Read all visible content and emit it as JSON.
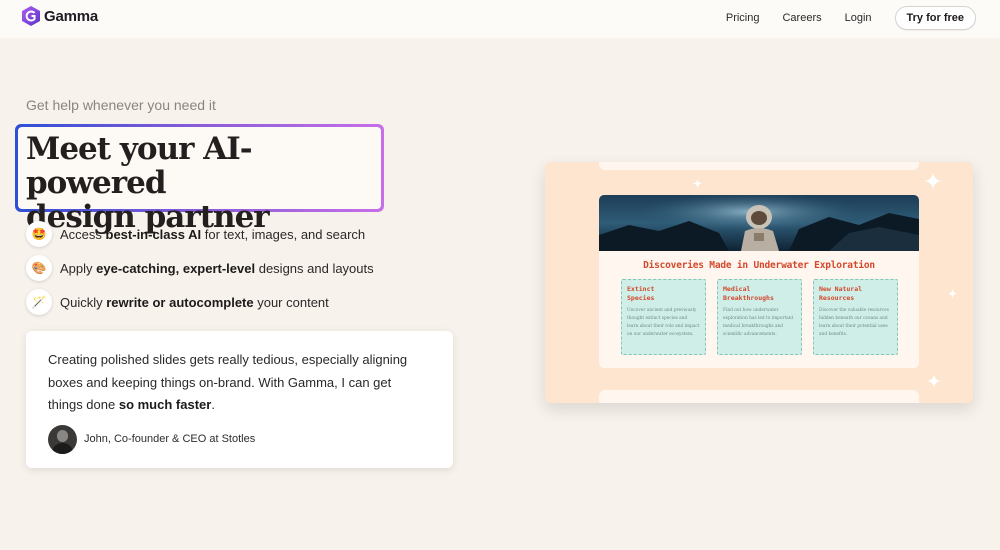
{
  "brand": {
    "name": "Gamma",
    "accent": "#7b4de0"
  },
  "nav": {
    "links": [
      "Pricing",
      "Careers",
      "Login"
    ],
    "cta": "Try for free"
  },
  "hero": {
    "eyebrow": "Get help whenever you need it",
    "headline_line1": "Meet your AI-powered",
    "headline_line2": "design partner",
    "gradient": [
      "#2e4fd6",
      "#8a5cd8",
      "#c86ee8"
    ]
  },
  "features": [
    {
      "icon": "star-struck-emoji-icon",
      "pre": "Access ",
      "bold": "best-in-class AI",
      "post": " for text, images, and search"
    },
    {
      "icon": "palette-icon",
      "pre": "Apply ",
      "bold": "eye-catching, expert-level",
      "post": " designs and layouts"
    },
    {
      "icon": "magic-wand-icon",
      "pre": "Quickly ",
      "bold": "rewrite or autocomplete",
      "post": " your content"
    }
  ],
  "testimonial": {
    "line1": "Creating polished slides gets really tedious, especially aligning",
    "line2": "boxes and keeping things on-brand. With Gamma, I can get",
    "line3_pre": "things done ",
    "line3_bold": "so much faster",
    "line3_post": ".",
    "author": "John, Co-founder & CEO at Stotles"
  },
  "preview": {
    "slide_title": "Discoveries Made in Underwater Exploration",
    "cards": [
      {
        "title1": "Extinct",
        "title2": "Species",
        "body": [
          "Uncover ancient and previously",
          "thought extinct species and",
          "learn about their role and impact",
          "on our underwater ecosystem."
        ]
      },
      {
        "title1": "Medical",
        "title2": "Breakthroughs",
        "body": [
          "Find out how underwater",
          "exploration has led to important",
          "medical breakthroughs and",
          "scientific advancements."
        ]
      },
      {
        "title1": "New Natural",
        "title2": "Resources",
        "body": [
          "Discover the valuable resources",
          "hidden beneath our oceans and",
          "learn about their potential uses",
          "and benefits."
        ]
      }
    ],
    "colors": {
      "background": "#fde5cf",
      "slide": "#fff7ef",
      "title": "#d4482c",
      "card": "#cfeee7"
    }
  }
}
